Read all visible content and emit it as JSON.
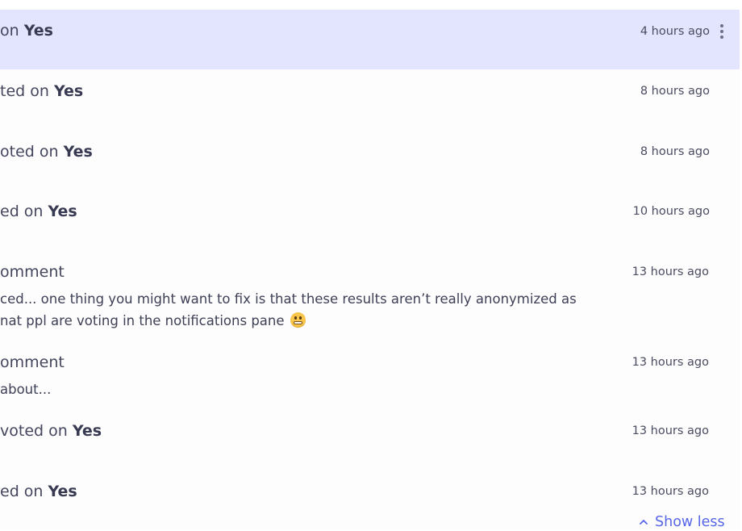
{
  "notifications": [
    {
      "action": "on ",
      "target": "Yes",
      "time": "4 hours ago"
    },
    {
      "action": "ted on ",
      "target": "Yes",
      "time": "8 hours ago"
    },
    {
      "action": "oted on ",
      "target": "Yes",
      "time": "8 hours ago"
    },
    {
      "action": "ed on ",
      "target": "Yes",
      "time": "10 hours ago"
    },
    {
      "title": "omment",
      "time": "13 hours ago",
      "body_line1": "ced... one thing you might want to fix is that these results aren’t really anonymized as",
      "body_line2": "nat ppl are voting in the notifications pane"
    },
    {
      "title": "omment",
      "time": "13 hours ago",
      "body_line1": "about..."
    },
    {
      "action": "voted on ",
      "target": "Yes",
      "time": "13 hours ago"
    },
    {
      "action": "ed on ",
      "target": "Yes",
      "time": "13 hours ago"
    }
  ],
  "show_less_label": "Show less",
  "icons": {
    "more": "more-vertical-icon",
    "emoji": "grimacing-face-emoji",
    "chevron": "chevron-up-icon"
  },
  "colors": {
    "highlight": "#e2e5fd",
    "link": "#5766e6",
    "text": "#3a3c52"
  }
}
